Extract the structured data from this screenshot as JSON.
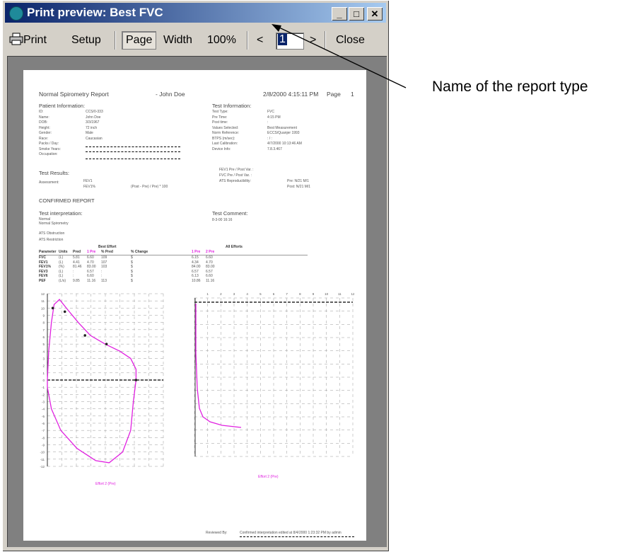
{
  "window": {
    "title": "Print preview: Best FVC",
    "min_label": "_",
    "max_label": "□",
    "close_label": "✕"
  },
  "toolbar": {
    "print": "Print",
    "setup": "Setup",
    "page": "Page",
    "width": "Width",
    "zoom": "100%",
    "prev": "<",
    "page_number": "1",
    "next": ">",
    "close": "Close"
  },
  "report": {
    "title": "Normal Spirometry Report",
    "patient_name": "- John Doe",
    "datetime": "2/8/2000 4:15:11 PM",
    "page": "Page",
    "page_num": "1",
    "patient_info": {
      "heading": "Patient Information:",
      "labels": [
        "ID:",
        "Name:",
        "DOB:",
        "Height:",
        "Gender:",
        "Race:",
        "Packs / Day:",
        "Smoke Years:",
        "Occupation:"
      ],
      "values": [
        "CCS/0-333",
        "John Doe",
        "3/3/1967",
        "72 inch",
        "Male",
        "Caucasian"
      ]
    },
    "test_info": {
      "heading": "Test Information:",
      "labels": [
        "Test Type:",
        "Pre Time:",
        "Post time:",
        "Values Selected:",
        "Norm Reference:",
        "BTPS (m/sec):",
        "Last Calibration:",
        "Device Info:"
      ],
      "values": [
        "FVC",
        "4:15 PM",
        ":",
        "Best Measurement",
        "ECCS/Quanjer 1993",
        ":    /  :",
        "4/7/2000 10:13:46 AM",
        "7.8.3.467"
      ]
    },
    "test_results": {
      "heading": "Test Results:",
      "assessment": "Assessment:",
      "fev1": "FEV1",
      "fev1pct": "FEV1%",
      "formula": "(Post - Pre) / Pre) * 100",
      "right_lines": [
        "FEV1 Pre / Post Var.  :",
        "FVC Pre / Post Var.  :",
        "ATS Reproducibility:"
      ],
      "right_vals": [
        "Pre:   N/21 M/1",
        "Post:   N/21 M/1"
      ]
    },
    "confirmed": "CONFIRMED REPORT",
    "interp": {
      "heading": "Test interpretation:",
      "lines": [
        "Normal",
        "Normal Spirometry",
        "ATS Obstruction",
        "ATS Restriction"
      ]
    },
    "comment": {
      "heading": "Test Comment:",
      "line": "8-3-00  16:16"
    },
    "table": {
      "best_effort": "Best Effort",
      "all_efforts": "All Efforts",
      "headers": [
        "Parameter",
        "Units",
        "Pred",
        "1 Pre",
        "% Pred",
        "% Change",
        "1 Pre",
        "2 Pre"
      ],
      "rows": [
        [
          "FVC",
          "(L)",
          "5.81",
          "6.60",
          "109",
          "$",
          "6.15",
          "6.60"
        ],
        [
          "FEV1",
          "(L)",
          "4.41",
          "4.70",
          "107",
          "$",
          "4.34",
          "4.70"
        ],
        [
          "FEV1%",
          "(%)",
          "81.46",
          "83.00",
          "103",
          "$",
          "84.00",
          "83.00"
        ],
        [
          "FEV3",
          "(L)",
          ":",
          "6.57",
          ":",
          "$",
          "6.57",
          "6.57"
        ],
        [
          "FEV6",
          "(L)",
          ":",
          "6.60",
          ":",
          "$",
          "6.13",
          "6.60"
        ],
        [
          "PEF",
          "(L/s)",
          "9.85",
          "11.16",
          "113",
          "$",
          "10.86",
          "11.16"
        ]
      ]
    },
    "chart_left": {
      "legend": "Effort 2 (Pre)",
      "y_ticks": [
        "12",
        "11",
        "10",
        "9",
        "8",
        "7",
        "6",
        "5",
        "4",
        "3",
        "2",
        "1",
        "0",
        "-1",
        "-2",
        "-3",
        "-4",
        "-5",
        "-6",
        "-7",
        "-8",
        "-9",
        "-10",
        "-11",
        "-12"
      ]
    },
    "chart_right": {
      "legend": "Effort 2 (Pre)",
      "x_ticks": [
        "1",
        "2",
        "3",
        "4",
        "5",
        "6",
        "7",
        "8",
        "9",
        "10",
        "11",
        "12"
      ]
    },
    "reviewed_by": "Reviewed By:",
    "confirmed_note": "Confirmed interpretation edited at 8/4/2000 1:23:32 PM by admin"
  },
  "annotation": {
    "text": "Name of the report type"
  },
  "colors": {
    "title_start": "#0a246a",
    "title_end": "#a6caf0",
    "curve": "#e020e0",
    "pred_header": "#e020e0"
  }
}
